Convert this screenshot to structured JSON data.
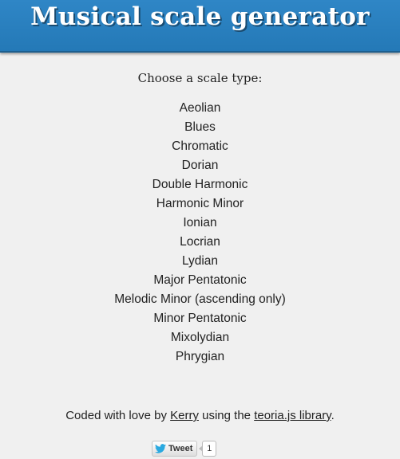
{
  "header": {
    "title": "Musical scale generator"
  },
  "main": {
    "prompt": "Choose a scale type:",
    "scales": [
      "Aeolian",
      "Blues",
      "Chromatic",
      "Dorian",
      "Double Harmonic",
      "Harmonic Minor",
      "Ionian",
      "Locrian",
      "Lydian",
      "Major Pentatonic",
      "Melodic Minor (ascending only)",
      "Minor Pentatonic",
      "Mixolydian",
      "Phrygian"
    ]
  },
  "footer": {
    "prefix": "Coded with love by ",
    "author_link": "Kerry",
    "middle": " using the ",
    "library_link": "teoria.js library",
    "suffix": "."
  },
  "tweet": {
    "label": "Tweet",
    "count": "1",
    "icon": "twitter-bird-icon"
  },
  "colors": {
    "header_bg": "#2a80bf",
    "page_bg": "#f0f0f0",
    "twitter_blue": "#2aa9e0"
  }
}
